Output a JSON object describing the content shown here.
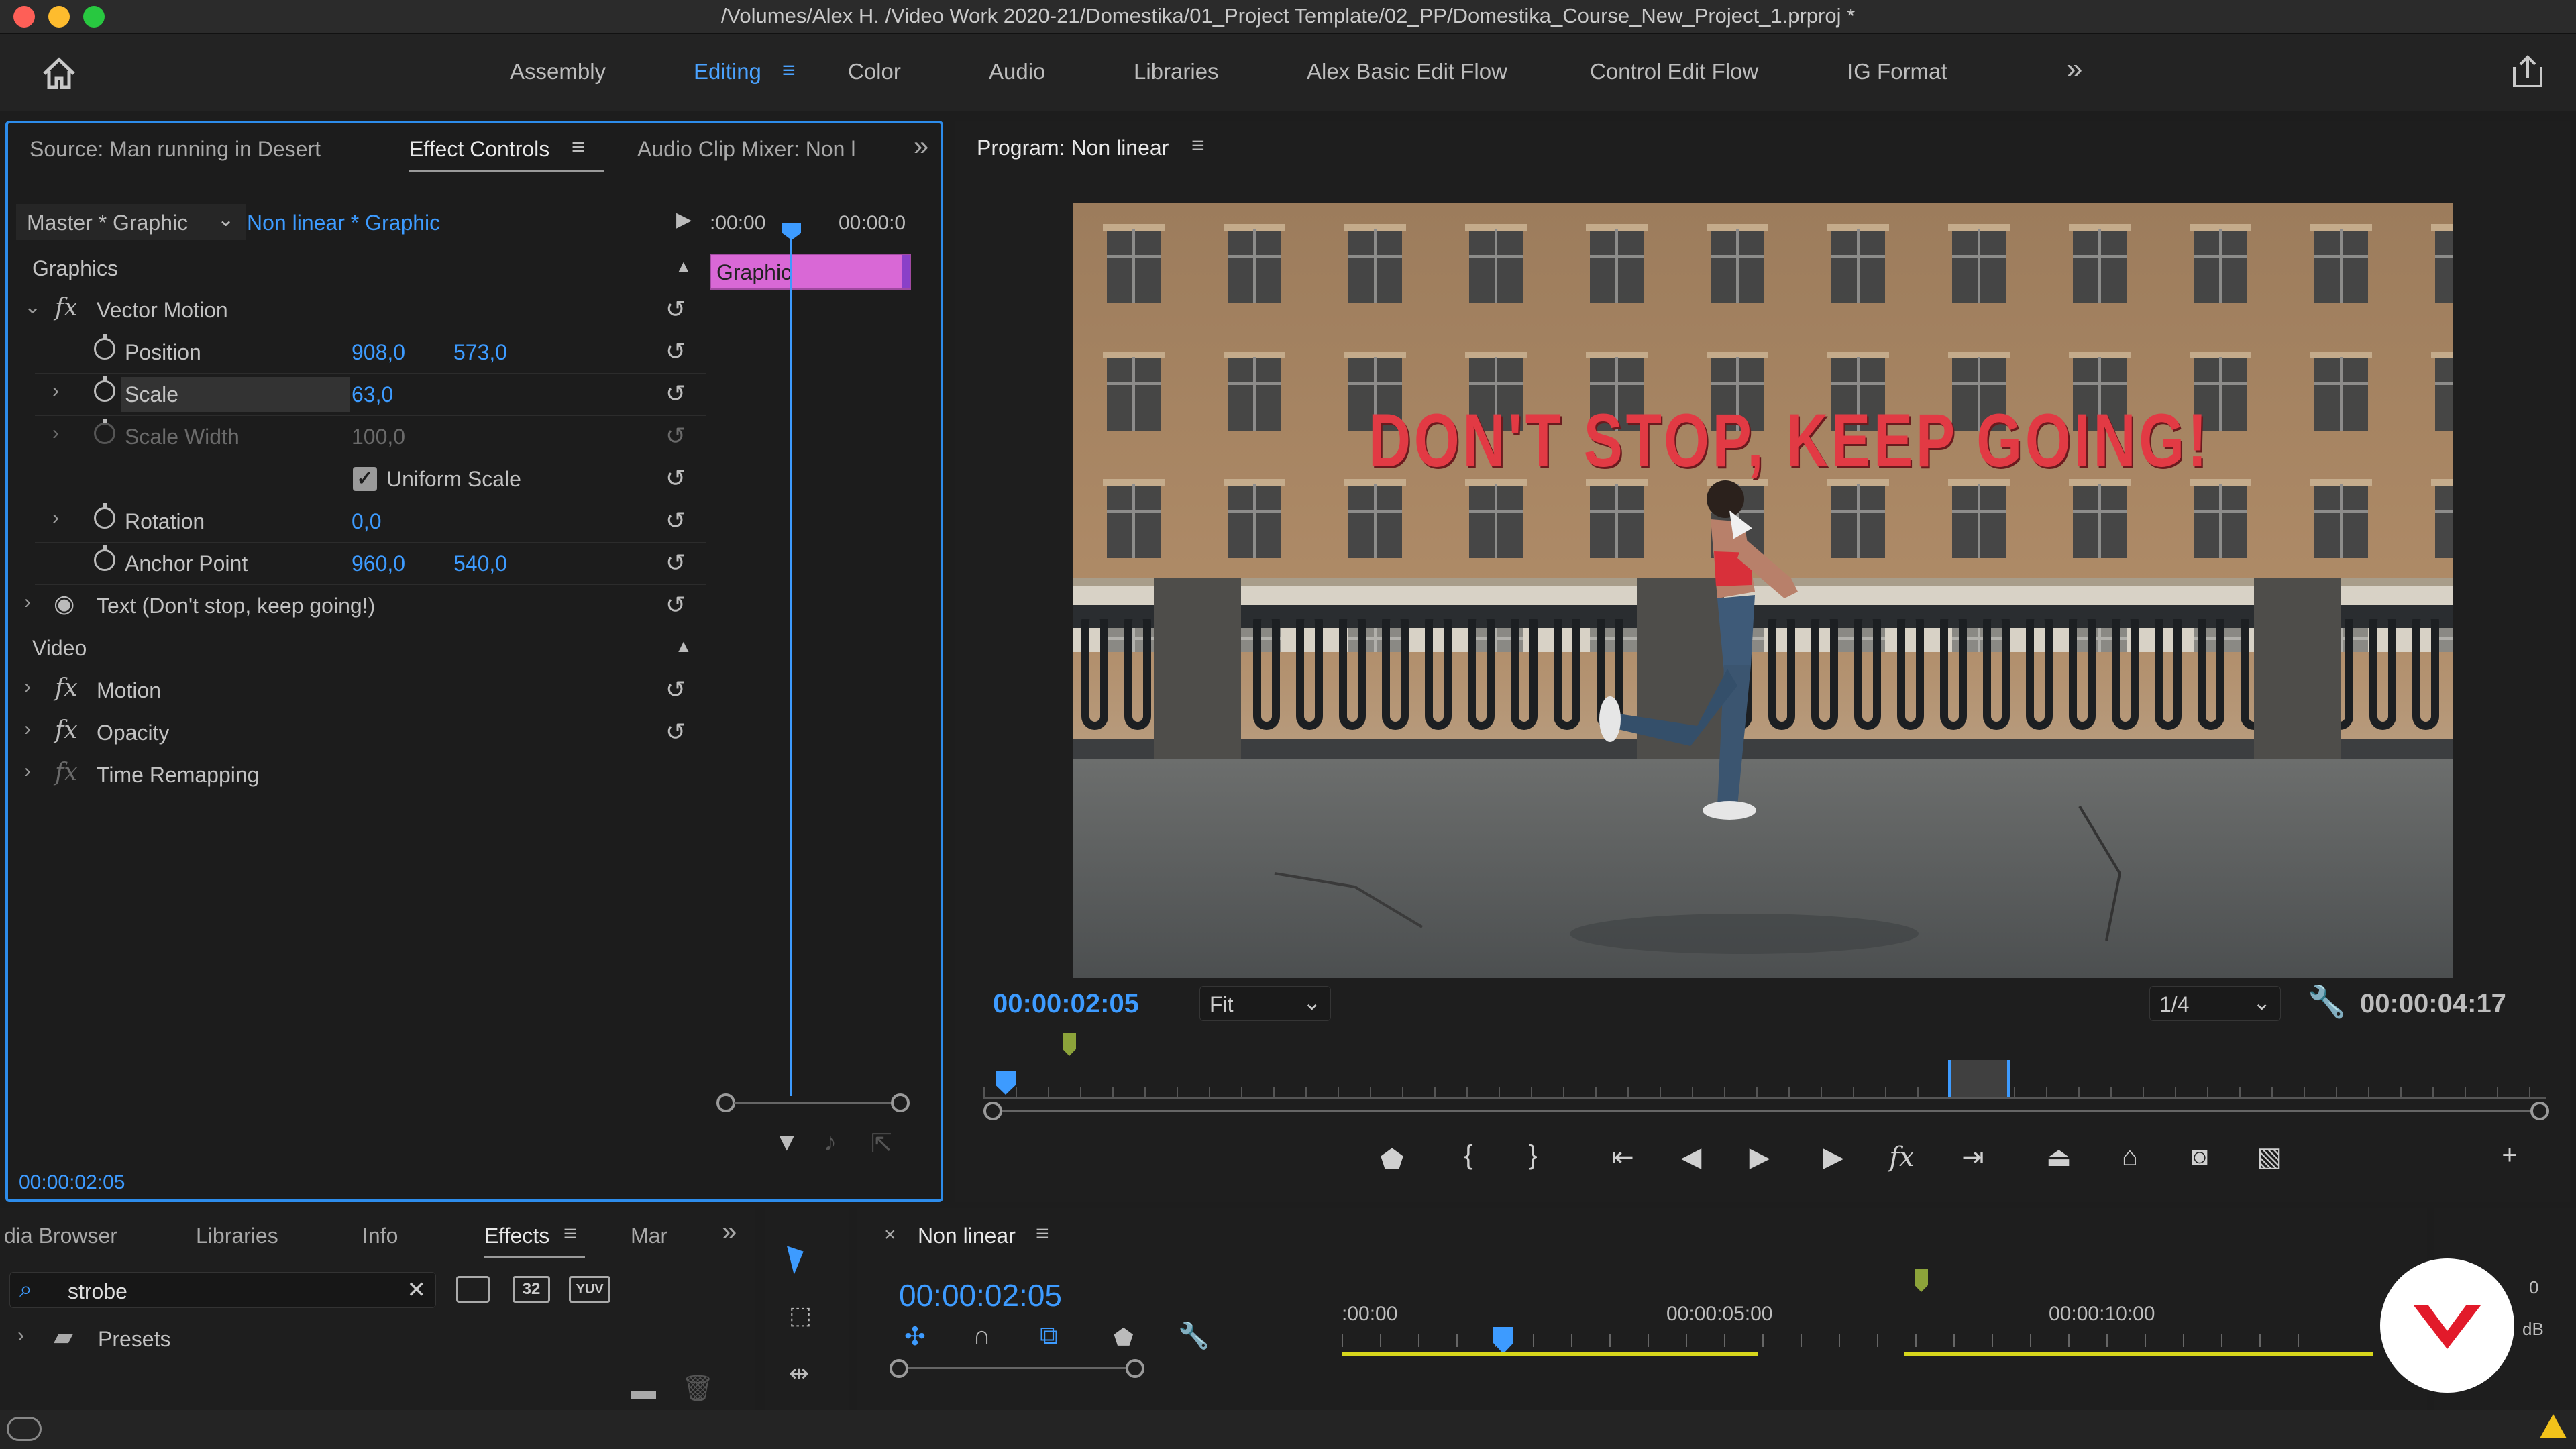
{
  "window": {
    "title": "/Volumes/Alex H. /Video Work 2020-21/Domestika/01_Project Template/02_PP/Domestika_Course_New_Project_1.prproj *"
  },
  "workspaces": {
    "items": [
      "Assembly",
      "Editing",
      "Color",
      "Audio",
      "Libraries",
      "Alex Basic Edit Flow",
      "Control Edit Flow",
      "IG Format"
    ],
    "active": "Editing",
    "more": "»"
  },
  "left_panel": {
    "tabs": [
      "Source: Man running in Desert",
      "Effect Controls",
      "Audio Clip Mixer: Non l"
    ],
    "more": "»",
    "master_label": "Master * Graphic",
    "sequence_label": "Non linear * Graphic",
    "mini_timeline": {
      "start": ":00:00",
      "end": "00:00:0",
      "clip_label": "Graphic"
    },
    "sections": {
      "graphics": "Graphics",
      "video": "Video"
    },
    "vector_motion": {
      "label": "Vector Motion",
      "position_label": "Position",
      "position_x": "908,0",
      "position_y": "573,0",
      "scale_label": "Scale",
      "scale_value": "63,0",
      "scale_width_label": "Scale Width",
      "scale_width_value": "100,0",
      "uniform_scale_label": "Uniform Scale",
      "uniform_scale_checked": true,
      "rotation_label": "Rotation",
      "rotation_value": "0,0",
      "anchor_label": "Anchor Point",
      "anchor_x": "960,0",
      "anchor_y": "540,0"
    },
    "text_layer": "Text (Don't stop, keep going!)",
    "video_effects": [
      "Motion",
      "Opacity",
      "Time Remapping"
    ],
    "timecode": "00:00:02:05"
  },
  "program_monitor": {
    "title": "Program: Non linear",
    "overlay_text": "DON'T STOP, KEEP GOING!",
    "current_timecode": "00:00:02:05",
    "zoom": "Fit",
    "resolution": "1/4",
    "duration": "00:00:04:17"
  },
  "effects_panel": {
    "tabs": [
      "dia Browser",
      "Libraries",
      "Info",
      "Effects",
      "Mar"
    ],
    "active": "Effects",
    "search_value": "strobe",
    "presets_label": "Presets",
    "badges": [
      "32",
      "YUV"
    ]
  },
  "timeline": {
    "sequence_name": "Non linear",
    "timecode": "00:00:02:05",
    "ruler": [
      ":00:00",
      "00:00:05:00",
      "00:00:10:00"
    ]
  },
  "meter": {
    "zero": "0",
    "unit": "dB"
  },
  "colors": {
    "accent": "#2d8ceb",
    "clip": "#d968d6",
    "work_area": "#d7d61c",
    "overlay_text": "#e23a44",
    "brand": "#e21a2a"
  }
}
